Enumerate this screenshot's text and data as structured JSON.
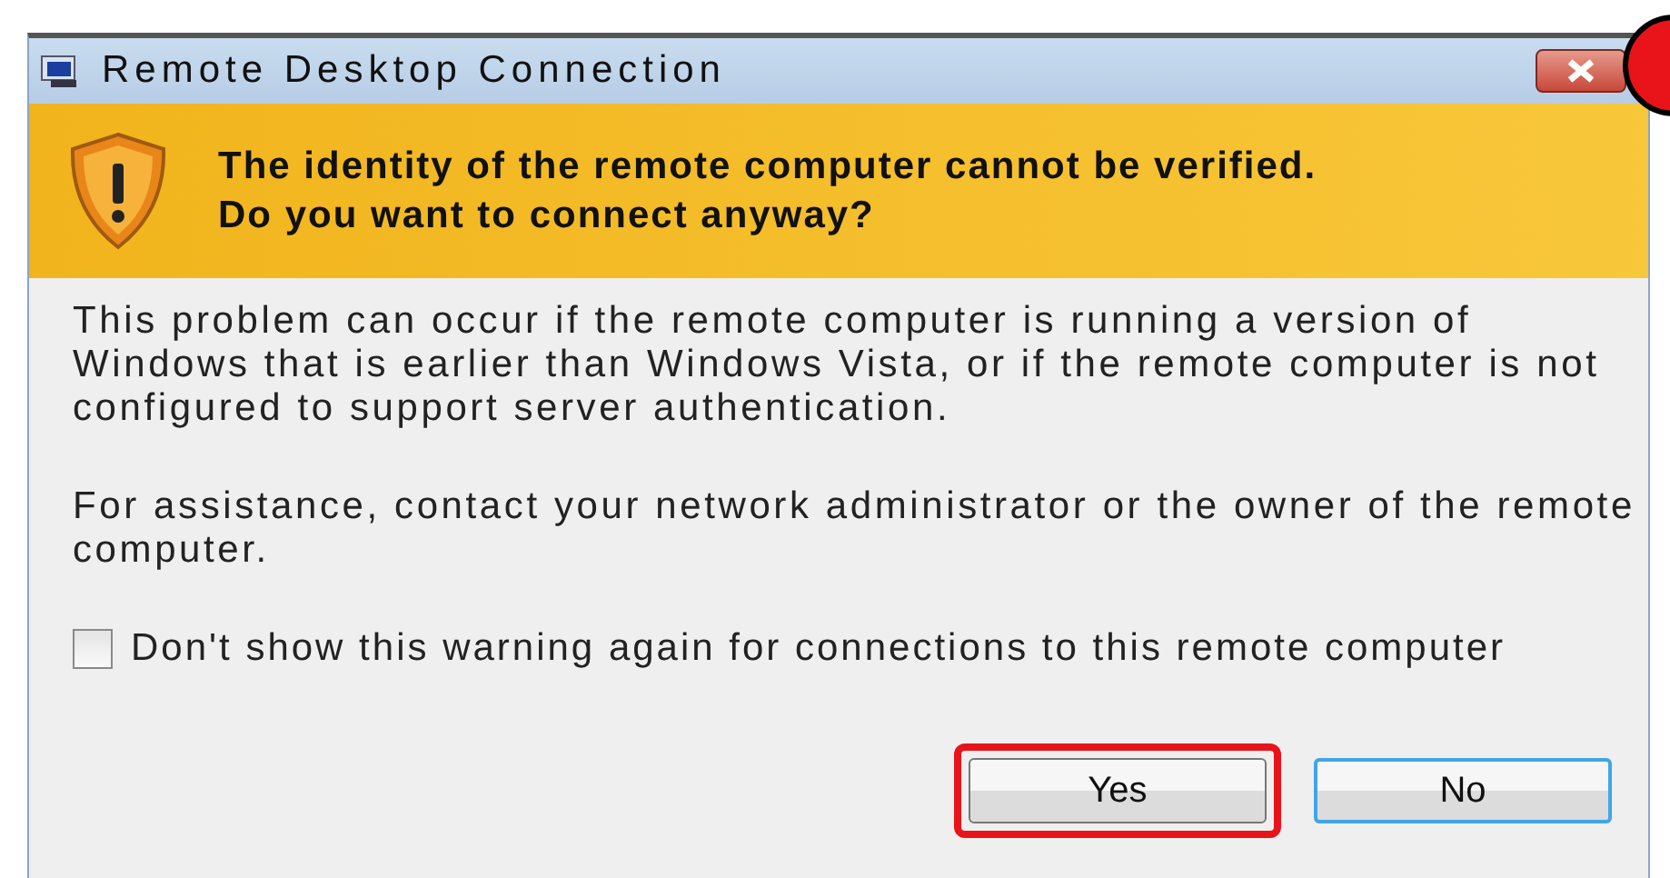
{
  "window": {
    "title": "Remote Desktop Connection"
  },
  "banner": {
    "message": "The identity of the remote computer cannot be verified. Do you want to connect anyway?"
  },
  "paragraphs": [
    "This problem can occur if the remote computer is running a version of Windows that is earlier than Windows Vista, or if the remote computer is not configured to support server authentication.",
    "For assistance, contact your network administrator or the owner of the remote computer."
  ],
  "checkbox": {
    "label": "Don't show this warning again for connections to this remote computer",
    "checked": false
  },
  "buttons": [
    {
      "label": "Yes",
      "highlighted": true,
      "default": false
    },
    {
      "label": "No",
      "highlighted": false,
      "default": true
    }
  ]
}
